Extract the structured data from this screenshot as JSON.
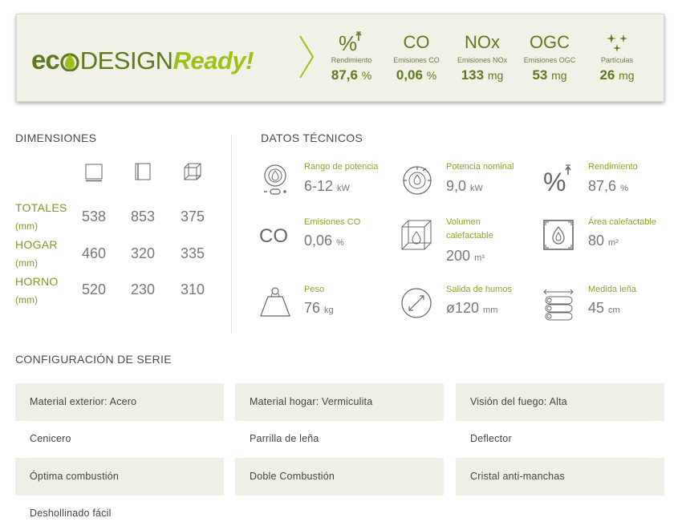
{
  "colors": {
    "brand_dark": "#5f7a1e",
    "brand_light": "#9cc21a",
    "label_green": "#7b9a25",
    "banner_bg": "#f1f1e7",
    "stripe_bg": "#efefe6"
  },
  "eco": {
    "logo": {
      "eco": "ec",
      "design": "DESIGN",
      "ready": "Ready!"
    },
    "metrics": [
      {
        "icon": "%",
        "label": "Rendimiento",
        "value": "87,6",
        "unit": "%"
      },
      {
        "icon": "CO",
        "label": "Emisiones CO",
        "value": "0,06",
        "unit": "%"
      },
      {
        "icon": "NOx",
        "label": "Emisiones NOx",
        "value": "133",
        "unit": "mg"
      },
      {
        "icon": "OGC",
        "label": "Emisiones OGC",
        "value": "53",
        "unit": "mg"
      },
      {
        "icon": "sparkles-icon",
        "label": "Partículas",
        "value": "26",
        "unit": "mg"
      }
    ]
  },
  "dimensions": {
    "title": "DIMENSIONES",
    "rows": [
      {
        "label": "TOTALES",
        "unit": "(mm)",
        "values": [
          "538",
          "853",
          "375"
        ]
      },
      {
        "label": "HOGAR",
        "unit": "(mm)",
        "values": [
          "460",
          "320",
          "335"
        ]
      },
      {
        "label": "HORNO",
        "unit": "(mm)",
        "values": [
          "520",
          "230",
          "310"
        ]
      }
    ]
  },
  "tech": {
    "title": "DATOS TÉCNICOS",
    "items": [
      {
        "icon": "power-range-icon",
        "label": "Rango de potencia",
        "value": "6-12",
        "unit": "kW"
      },
      {
        "icon": "nominal-power-icon",
        "label": "Potencia nominal",
        "value": "9,0",
        "unit": "kW"
      },
      {
        "icon": "efficiency-icon",
        "label": "Rendimiento",
        "value": "87,6",
        "unit": "%"
      },
      {
        "icon": "co-icon",
        "icon_text": "CO",
        "label": "Emisiones CO",
        "value": "0,06",
        "unit": "%"
      },
      {
        "icon": "volume-icon",
        "label": "Volumen calefactable",
        "value": "200",
        "unit": "m³"
      },
      {
        "icon": "heated-area-icon",
        "label": "Área calefactable",
        "value": "80",
        "unit": "m²"
      },
      {
        "icon": "weight-icon",
        "label": "Peso",
        "value": "76",
        "unit": "kg"
      },
      {
        "icon": "flue-outlet-icon",
        "label": "Salida de humos",
        "value": "ø120",
        "unit": "mm"
      },
      {
        "icon": "log-length-icon",
        "label": "Medida leña",
        "value": "45",
        "unit": "cm"
      }
    ]
  },
  "config": {
    "title": "CONFIGURACIÓN DE SERIE",
    "items": [
      "Material exterior: Acero",
      "Material hogar: Vermiculita",
      "Visión del fuego: Alta",
      "Cenicero",
      "Parrilla de leña",
      "Deflector",
      "Óptima combustión",
      "Doble Combustión",
      "Cristal anti-manchas",
      "Deshollinado fácil"
    ]
  }
}
